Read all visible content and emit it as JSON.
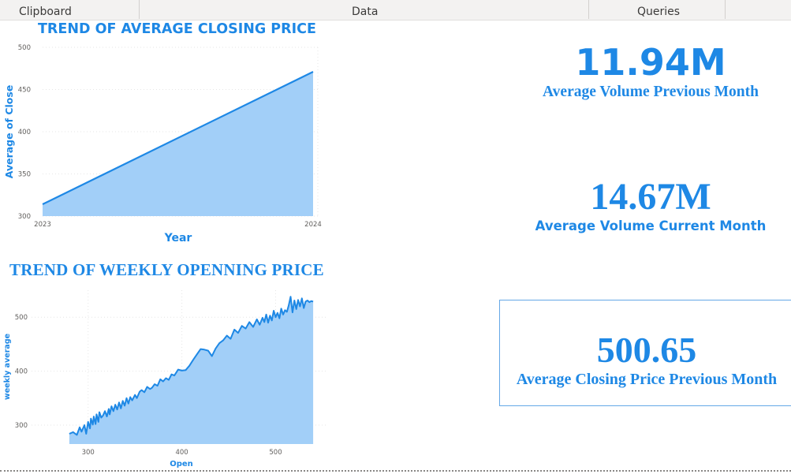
{
  "ribbon": {
    "groups": [
      "Clipboard",
      "Data",
      "Queries"
    ]
  },
  "colors": {
    "accent": "#1e88e5",
    "fill": "#a2cff8"
  },
  "kpis": {
    "volume_prev": {
      "value": "11.94M",
      "label": "Average Volume Previous Month"
    },
    "volume_curr": {
      "value": "14.67M",
      "label": "Average Volume Current Month"
    },
    "close_prev": {
      "value": "500.65",
      "label": "Average Closing Price Previous Month"
    }
  },
  "chart_data": [
    {
      "type": "area",
      "title": "TREND OF AVERAGE CLOSING PRICE",
      "xlabel": "Year",
      "ylabel": "Average of Close",
      "x": [
        "2023",
        "2024"
      ],
      "values": [
        314,
        471
      ],
      "ylim": [
        300,
        500
      ],
      "yticks": [
        300,
        350,
        400,
        450,
        500
      ],
      "grid": true
    },
    {
      "type": "area",
      "title": "TREND OF WEEKLY OPENNING PRICE",
      "xlabel": "Open",
      "ylabel": "weekly average",
      "xlim": [
        275,
        545
      ],
      "ylim": [
        265,
        550
      ],
      "xticks": [
        300,
        400,
        500
      ],
      "yticks": [
        300,
        400,
        500
      ],
      "grid": true,
      "x": [
        280,
        284,
        288,
        291,
        293,
        296,
        298,
        300,
        302,
        303,
        305,
        306,
        308,
        309,
        311,
        312,
        314,
        316,
        318,
        320,
        322,
        323,
        325,
        327,
        329,
        331,
        333,
        335,
        337,
        339,
        341,
        343,
        345,
        347,
        350,
        352,
        355,
        357,
        360,
        363,
        366,
        368,
        371,
        374,
        377,
        380,
        383,
        386,
        389,
        392,
        396,
        400,
        404,
        408,
        412,
        416,
        420,
        424,
        428,
        432,
        436,
        440,
        444,
        448,
        452,
        456,
        460,
        464,
        468,
        472,
        476,
        480,
        483,
        486,
        488,
        490,
        492,
        494,
        496,
        498,
        500,
        502,
        504,
        506,
        508,
        510,
        512,
        514,
        516,
        518,
        520,
        522,
        524,
        526,
        528,
        530,
        532,
        534,
        536,
        538,
        540
      ],
      "values": [
        284,
        287,
        282,
        296,
        288,
        300,
        284,
        306,
        294,
        312,
        301,
        316,
        302,
        320,
        306,
        324,
        314,
        318,
        326,
        316,
        330,
        320,
        335,
        326,
        338,
        329,
        342,
        331,
        345,
        336,
        350,
        340,
        352,
        346,
        356,
        350,
        362,
        365,
        361,
        371,
        367,
        369,
        376,
        373,
        385,
        381,
        387,
        384,
        394,
        392,
        403,
        401,
        402,
        410,
        421,
        431,
        441,
        440,
        438,
        428,
        442,
        452,
        457,
        466,
        460,
        477,
        471,
        484,
        479,
        491,
        482,
        496,
        486,
        499,
        491,
        505,
        490,
        503,
        494,
        512,
        500,
        508,
        498,
        516,
        505,
        513,
        510,
        522,
        538,
        509,
        531,
        515,
        532,
        520,
        535,
        517,
        529,
        531,
        528,
        530,
        529
      ]
    }
  ]
}
